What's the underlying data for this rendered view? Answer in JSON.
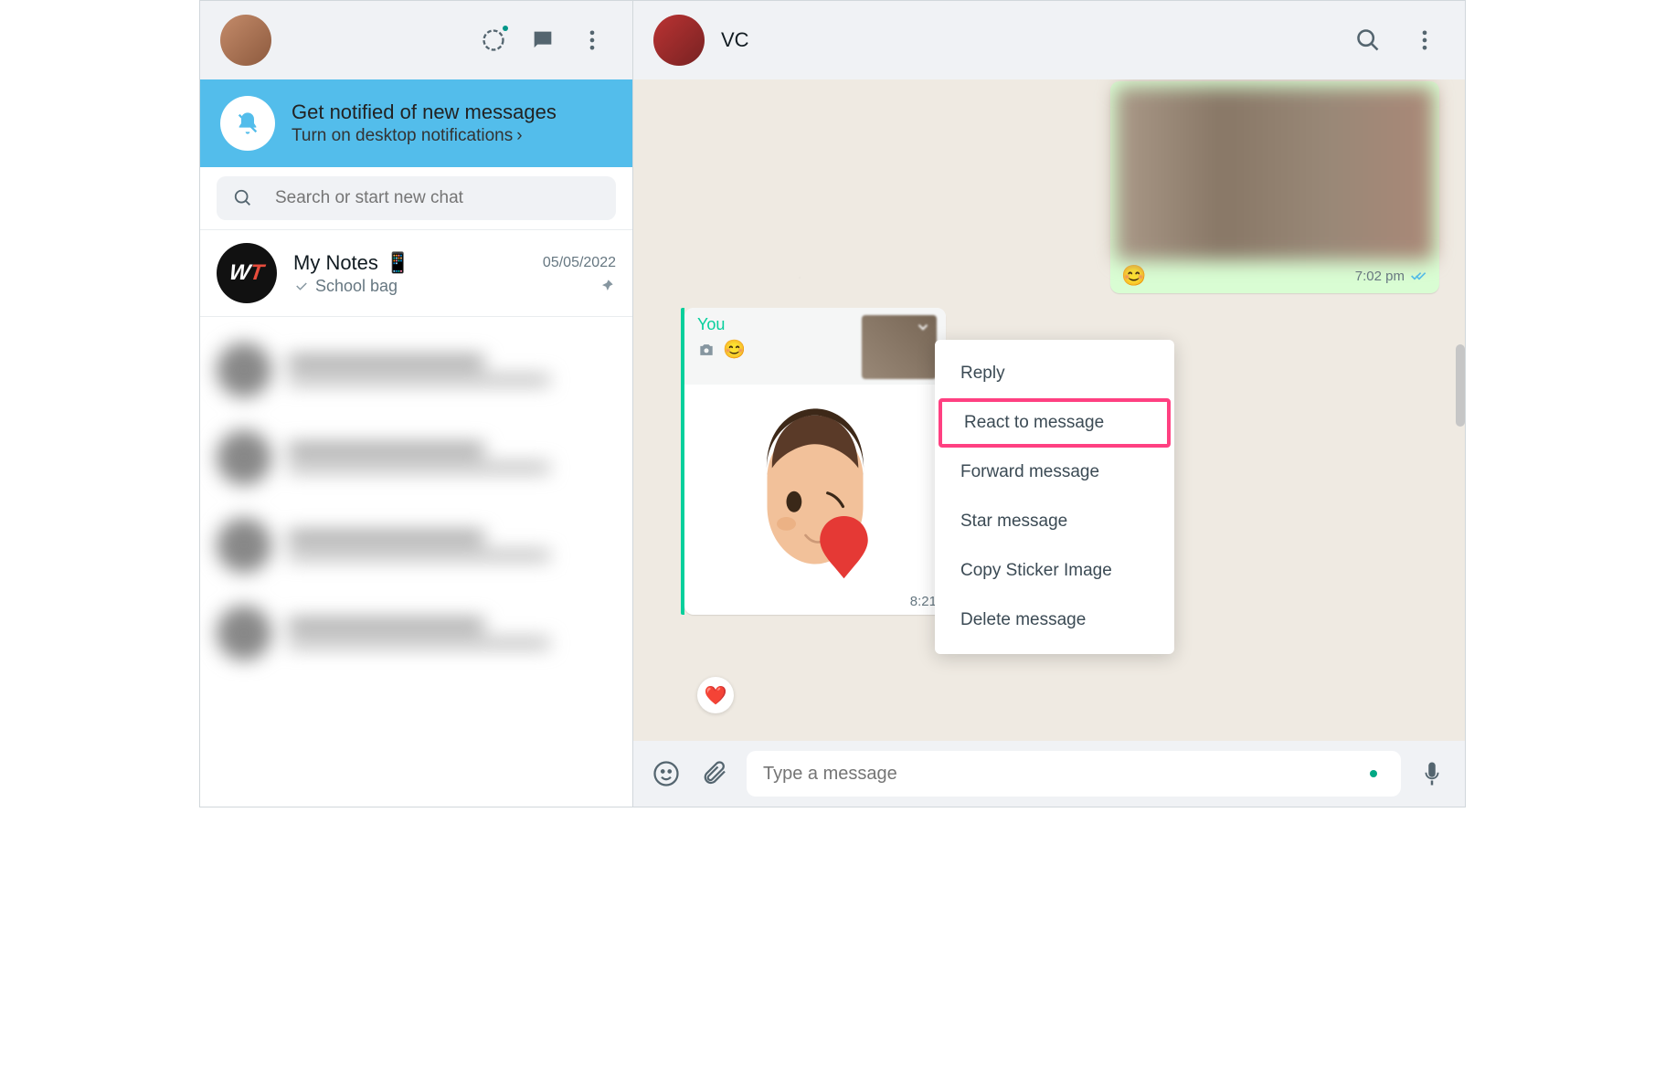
{
  "sidebar": {
    "notification": {
      "title": "Get notified of new messages",
      "subtitle": "Turn on desktop notifications"
    },
    "search_placeholder": "Search or start new chat",
    "chats": [
      {
        "name": "My Notes",
        "name_emoji": "📱",
        "date": "05/05/2022",
        "preview": "School bag",
        "pinned": true
      }
    ]
  },
  "chat": {
    "contact_name": "VC",
    "outgoing": {
      "caption_emoji": "😊",
      "time": "7:02 pm"
    },
    "incoming": {
      "sender": "You",
      "caption_emoji": "😊",
      "time": "8:21"
    },
    "reaction": "❤️",
    "composer_placeholder": "Type a message"
  },
  "context_menu": {
    "items": [
      "Reply",
      "React to message",
      "Forward message",
      "Star message",
      "Copy Sticker Image",
      "Delete message"
    ],
    "highlighted_index": 1
  }
}
